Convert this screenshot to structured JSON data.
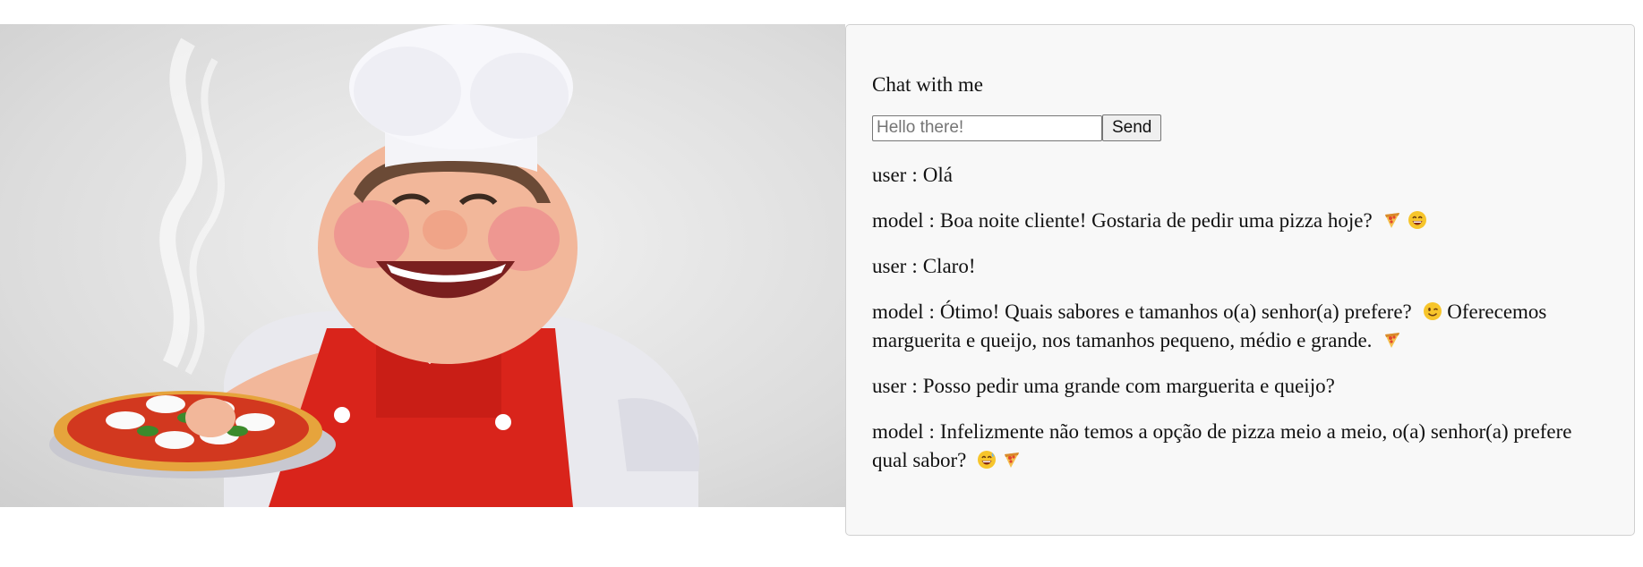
{
  "chat": {
    "title": "Chat with me",
    "input_placeholder": "Hello there!",
    "input_value": "",
    "send_label": "Send"
  },
  "messages": [
    {
      "role": "user",
      "text": "Olá",
      "emojis": []
    },
    {
      "role": "model",
      "text": "Boa noite cliente! Gostaria de pedir uma pizza hoje?",
      "emojis": [
        "pizza-emoji",
        "grinning-emoji"
      ]
    },
    {
      "role": "user",
      "text": "Claro!",
      "emojis": []
    },
    {
      "role": "model",
      "text": "Ótimo! Quais sabores e tamanhos o(a) senhor(a) prefere?",
      "emojis": [
        "winking-emoji"
      ],
      "text2": "Oferecemos marguerita e queijo, nos tamanhos pequeno, médio e grande.",
      "emojis2": [
        "pizza-emoji"
      ]
    },
    {
      "role": "user",
      "text": "Posso pedir uma grande com marguerita e queijo?",
      "emojis": []
    },
    {
      "role": "model",
      "text": "Infelizmente não temos a opção de pizza meio a meio, o(a) senhor(a) prefere qual sabor?",
      "emojis": [
        "sweat-smile-emoji",
        "pizza-emoji"
      ]
    }
  ],
  "separator": ":",
  "colors": {
    "apron": "#d9241b",
    "panel_bg": "#f8f8f8",
    "skin": "#f2b79a"
  }
}
